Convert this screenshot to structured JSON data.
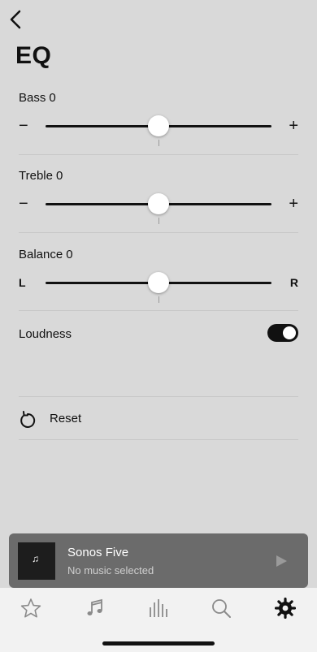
{
  "page": {
    "title": "EQ"
  },
  "bass": {
    "label": "Bass",
    "value": "0",
    "min_symbol": "−",
    "max_symbol": "+",
    "level": 0.5
  },
  "treble": {
    "label": "Treble",
    "value": "0",
    "min_symbol": "−",
    "max_symbol": "+",
    "level": 0.5
  },
  "balance": {
    "label": "Balance",
    "value": "0",
    "min_symbol": "L",
    "max_symbol": "R",
    "level": 0.5
  },
  "loudness": {
    "label": "Loudness",
    "on": true
  },
  "reset": {
    "label": "Reset"
  },
  "now_playing": {
    "title": "Sonos Five",
    "subtitle": "No music selected"
  },
  "tabs": [
    "favorites-icon",
    "music-icon",
    "rooms-icon",
    "search-icon",
    "settings-icon"
  ],
  "colors": {
    "background": "#d9d9d9",
    "player": "#6b6b6b",
    "tabbar": "#f2f2f2",
    "active_tab": "#111111",
    "inactive_tab": "#8a8a8a"
  }
}
